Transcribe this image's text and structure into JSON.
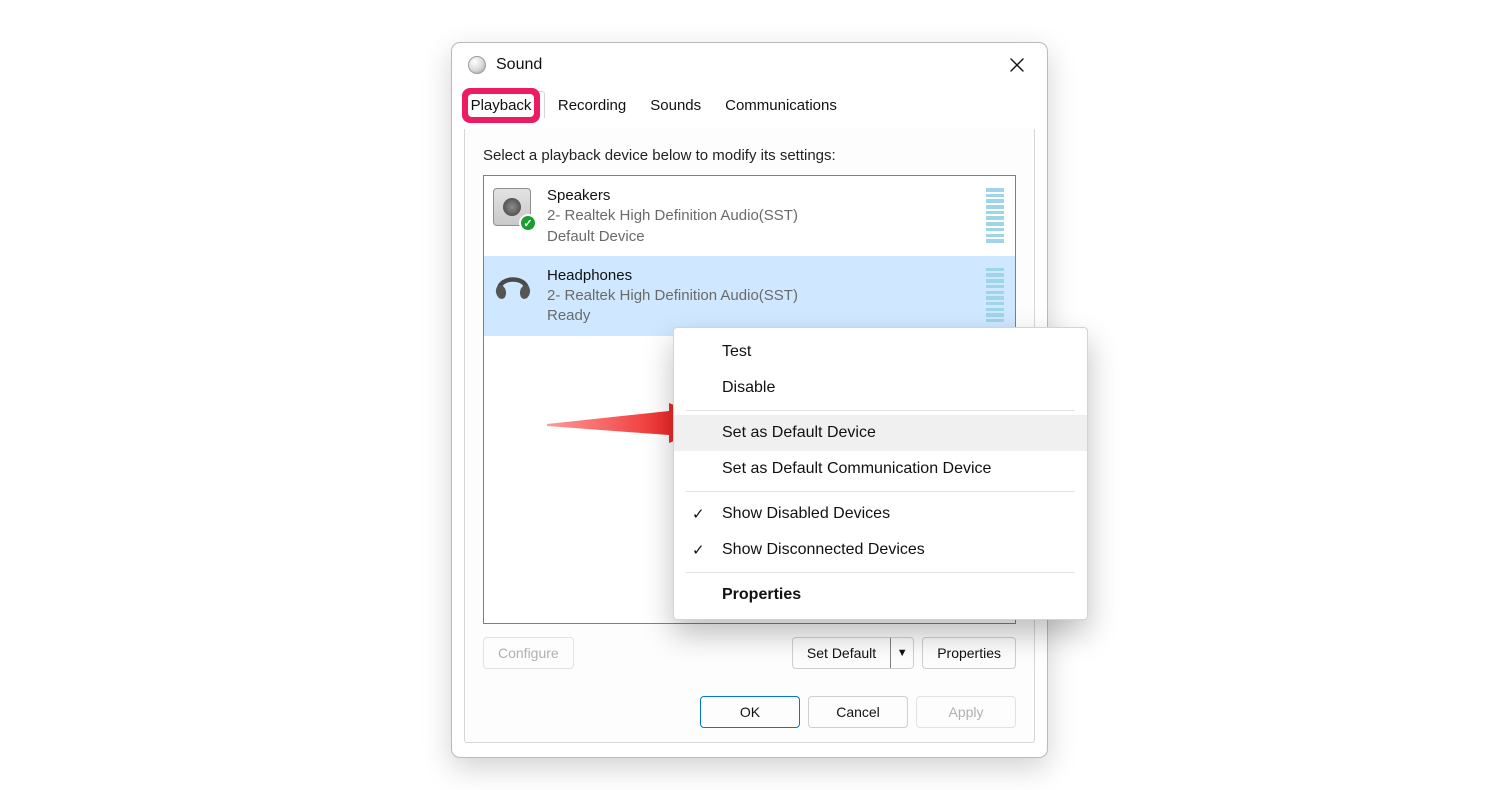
{
  "window": {
    "title": "Sound"
  },
  "tabs": [
    "Playback",
    "Recording",
    "Sounds",
    "Communications"
  ],
  "active_tab_index": 0,
  "instruction": "Select a playback device below to modify its settings:",
  "devices": [
    {
      "name": "Speakers",
      "sub": "2- Realtek High Definition Audio(SST)",
      "status": "Default Device",
      "icon": "speaker",
      "default": true,
      "selected": false
    },
    {
      "name": "Headphones",
      "sub": "2- Realtek High Definition Audio(SST)",
      "status": "Ready",
      "icon": "headphones",
      "default": false,
      "selected": true
    }
  ],
  "buttons": {
    "configure": "Configure",
    "set_default": "Set Default",
    "properties": "Properties",
    "ok": "OK",
    "cancel": "Cancel",
    "apply": "Apply"
  },
  "context_menu": {
    "test": "Test",
    "disable": "Disable",
    "set_default": "Set as Default Device",
    "set_default_comm": "Set as Default Communication Device",
    "show_disabled": "Show Disabled Devices",
    "show_disconnected": "Show Disconnected Devices",
    "properties": "Properties",
    "hover_index": 2,
    "show_disabled_checked": true,
    "show_disconnected_checked": true
  },
  "annotation": {
    "highlight_tab": "Playback"
  }
}
